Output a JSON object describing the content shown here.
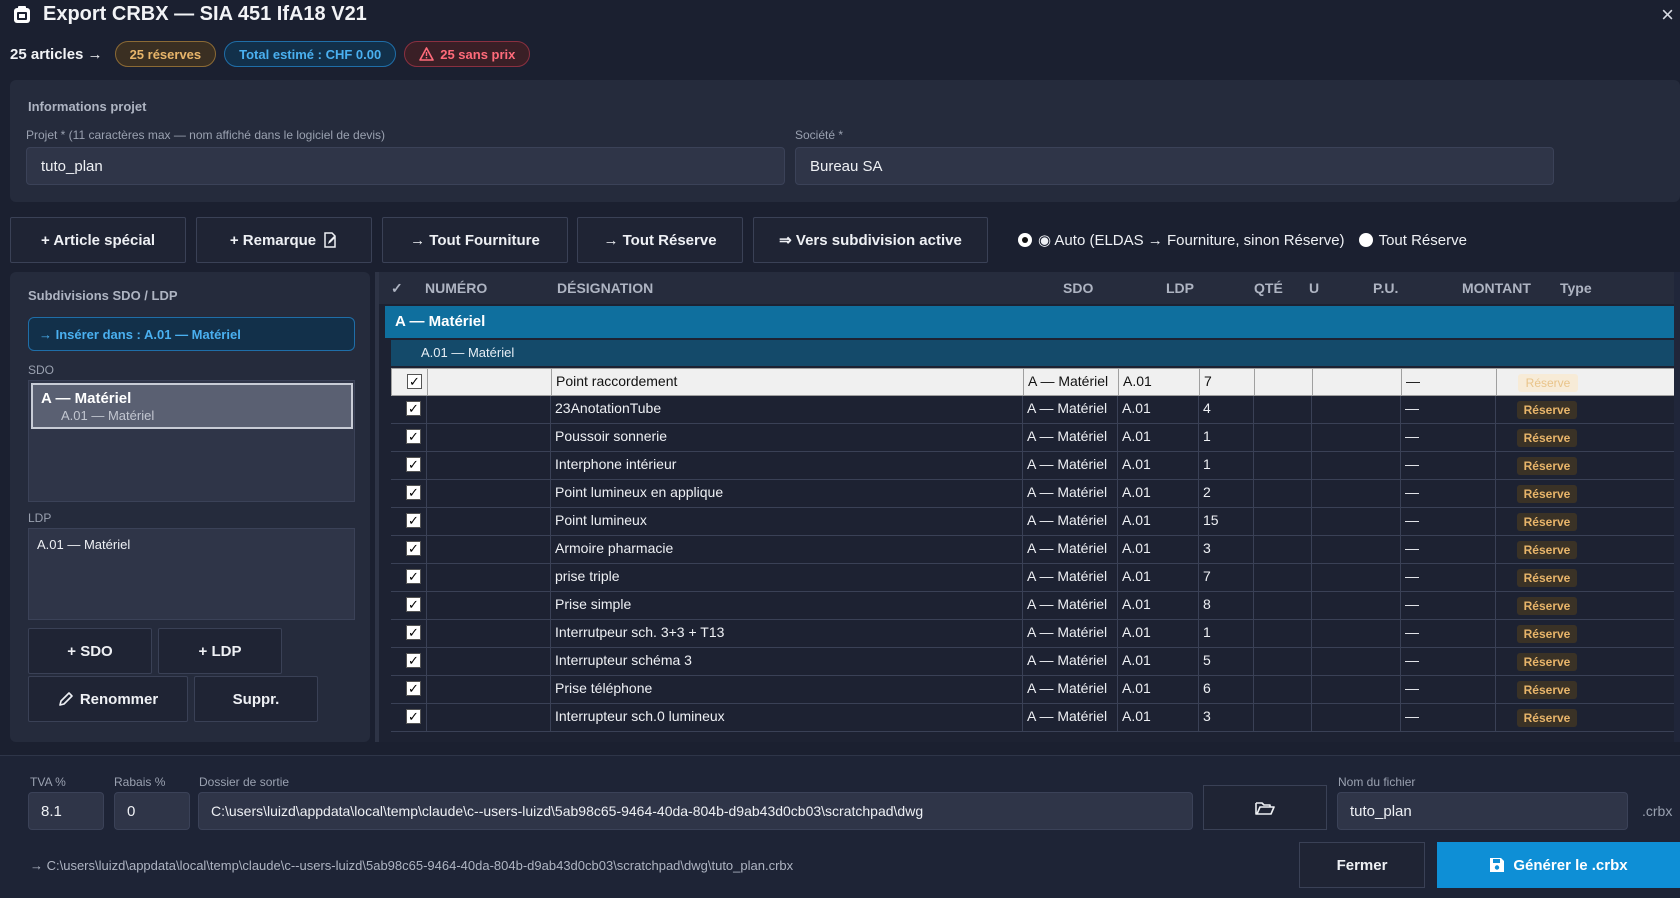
{
  "window": {
    "title": "Export CRBX — SIA 451 IfA18 V21",
    "close_glyph": "×"
  },
  "summary": {
    "count_label": "25 articles →",
    "reserves": "25 réserves",
    "total": "Total estimé : CHF 0.00",
    "no_price": "25 sans prix",
    "no_price_icon": "warning-icon"
  },
  "project": {
    "heading": "Informations projet",
    "project_label": "Projet * (11 caractères max — nom affiché dans le logiciel de devis)",
    "project_value": "tuto_plan",
    "company_label": "Société *",
    "company_value": "Bureau SA"
  },
  "toolbar": {
    "special_article": "+ Article spécial",
    "remark": "+ Remarque",
    "all_supply": "→ Tout Fourniture",
    "all_reserve": "→ Tout Réserve",
    "to_subdivision": "⇒ Vers subdivision active",
    "radio_auto": "◉ Auto (ELDAS → Fourniture, sinon Réserve)",
    "radio_reserve": "Tout Réserve",
    "selected_radio": "auto"
  },
  "subdivisions": {
    "heading": "Subdivisions SDO / LDP",
    "insert_into": "→ Insérer dans : A.01 — Matériel",
    "sdo_label": "SDO",
    "sdo_selected_title": "A — Matériel",
    "sdo_selected_sub": "A.01 — Matériel",
    "ldp_label": "LDP",
    "ldp_item": "A.01 — Matériel",
    "add_sdo": "+ SDO",
    "add_ldp": "+ LDP",
    "rename": "Renommer",
    "delete": "Suppr."
  },
  "table": {
    "headers": {
      "check": "✓",
      "numero": "NUMÉRO",
      "designation": "DÉSIGNATION",
      "sdo": "SDO",
      "ldp": "LDP",
      "qte": "QTÉ",
      "u": "U",
      "pu": "P.U.",
      "montant": "MONTANT",
      "type": "Type"
    },
    "group": "A — Matériel",
    "subgroup": "A.01 — Matériel",
    "rows": [
      {
        "checked": "✓",
        "numero": "",
        "designation": "Point raccordement",
        "sdo": "A — Matériel",
        "ldp": "A.01",
        "qte": "7",
        "u": "",
        "pu": "",
        "montant": "—",
        "type": "Réserve"
      },
      {
        "checked": "✓",
        "numero": "",
        "designation": "23AnotationTube",
        "sdo": "A — Matériel",
        "ldp": "A.01",
        "qte": "4",
        "u": "",
        "pu": "",
        "montant": "—",
        "type": "Réserve"
      },
      {
        "checked": "✓",
        "numero": "",
        "designation": "Poussoir sonnerie",
        "sdo": "A — Matériel",
        "ldp": "A.01",
        "qte": "1",
        "u": "",
        "pu": "",
        "montant": "—",
        "type": "Réserve"
      },
      {
        "checked": "✓",
        "numero": "",
        "designation": "Interphone intérieur",
        "sdo": "A — Matériel",
        "ldp": "A.01",
        "qte": "1",
        "u": "",
        "pu": "",
        "montant": "—",
        "type": "Réserve"
      },
      {
        "checked": "✓",
        "numero": "",
        "designation": "Point lumineux en applique",
        "sdo": "A — Matériel",
        "ldp": "A.01",
        "qte": "2",
        "u": "",
        "pu": "",
        "montant": "—",
        "type": "Réserve"
      },
      {
        "checked": "✓",
        "numero": "",
        "designation": "Point lumineux",
        "sdo": "A — Matériel",
        "ldp": "A.01",
        "qte": "15",
        "u": "",
        "pu": "",
        "montant": "—",
        "type": "Réserve"
      },
      {
        "checked": "✓",
        "numero": "",
        "designation": "Armoire pharmacie",
        "sdo": "A — Matériel",
        "ldp": "A.01",
        "qte": "3",
        "u": "",
        "pu": "",
        "montant": "—",
        "type": "Réserve"
      },
      {
        "checked": "✓",
        "numero": "",
        "designation": "prise triple",
        "sdo": "A — Matériel",
        "ldp": "A.01",
        "qte": "7",
        "u": "",
        "pu": "",
        "montant": "—",
        "type": "Réserve"
      },
      {
        "checked": "✓",
        "numero": "",
        "designation": "Prise simple",
        "sdo": "A — Matériel",
        "ldp": "A.01",
        "qte": "8",
        "u": "",
        "pu": "",
        "montant": "—",
        "type": "Réserve"
      },
      {
        "checked": "✓",
        "numero": "",
        "designation": "Interrutpeur sch. 3+3 + T13",
        "sdo": "A — Matériel",
        "ldp": "A.01",
        "qte": "1",
        "u": "",
        "pu": "",
        "montant": "—",
        "type": "Réserve"
      },
      {
        "checked": "✓",
        "numero": "",
        "designation": "Interrupteur schéma 3",
        "sdo": "A — Matériel",
        "ldp": "A.01",
        "qte": "5",
        "u": "",
        "pu": "",
        "montant": "—",
        "type": "Réserve"
      },
      {
        "checked": "✓",
        "numero": "",
        "designation": "Prise téléphone",
        "sdo": "A — Matériel",
        "ldp": "A.01",
        "qte": "6",
        "u": "",
        "pu": "",
        "montant": "—",
        "type": "Réserve"
      },
      {
        "checked": "✓",
        "numero": "",
        "designation": "Interrupteur sch.0 lumineux",
        "sdo": "A — Matériel",
        "ldp": "A.01",
        "qte": "3",
        "u": "",
        "pu": "",
        "montant": "—",
        "type": "Réserve"
      }
    ]
  },
  "bottom": {
    "tva_label": "TVA %",
    "tva_value": "8.1",
    "rabais_label": "Rabais %",
    "rabais_value": "0",
    "dossier_label": "Dossier de sortie",
    "dossier_value": "C:\\users\\luizd\\appdata\\local\\temp\\claude\\c--users-luizd\\5ab98c65-9464-40da-804b-d9ab43d0cb03\\scratchpad\\dwg",
    "filename_label": "Nom du fichier",
    "filename_value": "tuto_plan",
    "extension": ".crbx",
    "output_path": "→ C:\\users\\luizd\\appdata\\local\\temp\\claude\\c--users-luizd\\5ab98c65-9464-40da-804b-d9ab43d0cb03\\scratchpad\\dwg\\tuto_plan.crbx",
    "close": "Fermer",
    "generate": "Générer le .crbx"
  },
  "colors": {
    "background": "#1b2030",
    "panel": "#252b3c",
    "accent": "#0e8fd6",
    "group_row": "#0f6f9e",
    "reserve_text": "#e8b56a",
    "error_text": "#ff6b7a"
  }
}
